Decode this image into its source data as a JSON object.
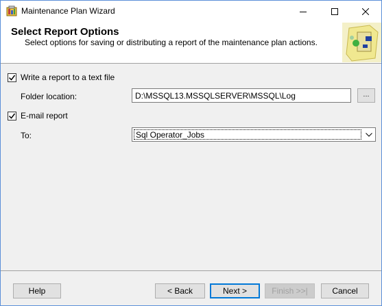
{
  "window": {
    "title": "Maintenance Plan Wizard"
  },
  "header": {
    "title": "Select Report Options",
    "subtitle": "Select options for saving or distributing a report of the maintenance plan actions."
  },
  "write_report": {
    "label": "Write a report to a text file",
    "checked": true
  },
  "folder": {
    "label": "Folder location:",
    "value": "D:\\MSSQL13.MSSQLSERVER\\MSSQL\\Log",
    "browse_label": "..."
  },
  "email_report": {
    "label": "E-mail report",
    "checked": true
  },
  "to": {
    "label": "To:",
    "selected": "Sql Operator_Jobs"
  },
  "buttons": {
    "help": "Help",
    "back": "< Back",
    "next": "Next >",
    "finish": "Finish >>|",
    "cancel": "Cancel"
  },
  "colors": {
    "accent": "#0078d7",
    "titlebar": "#ffffff",
    "body": "#f0f0f0"
  }
}
